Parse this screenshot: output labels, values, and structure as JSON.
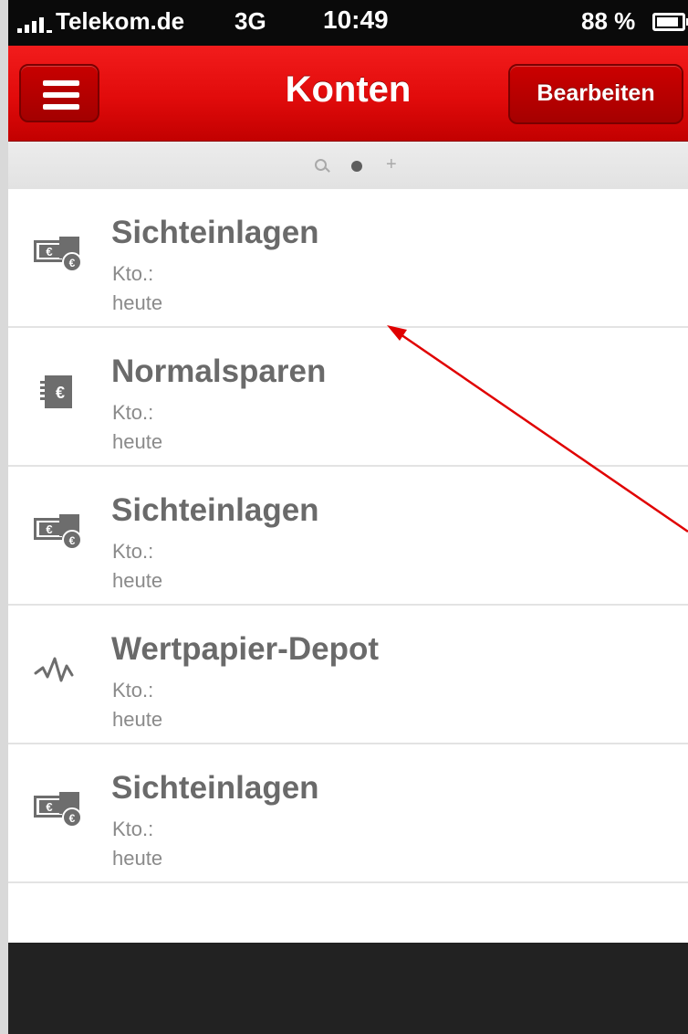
{
  "status_bar": {
    "carrier": "Telekom.de",
    "network": "3G",
    "time": "10:49",
    "battery_percent": "88 %",
    "battery_level": 0.88
  },
  "nav_bar": {
    "title": "Konten",
    "edit_label": "Bearbeiten",
    "accent_color": "#e10b0b"
  },
  "pager": {
    "pages": [
      "search",
      "accounts",
      "add"
    ],
    "active_page": "accounts"
  },
  "accounts": [
    {
      "name": "Sichteinlagen",
      "account_label": "Kto.:",
      "date": "heute",
      "icon": "cash-euro-icon"
    },
    {
      "name": "Normalsparen",
      "account_label": "Kto.:",
      "date": "heute",
      "icon": "savings-book-euro-icon"
    },
    {
      "name": "Sichteinlagen",
      "account_label": "Kto.:",
      "date": "heute",
      "icon": "cash-euro-icon"
    },
    {
      "name": "Wertpapier-Depot",
      "account_label": "Kto.:",
      "date": "heute",
      "icon": "stock-chart-icon"
    },
    {
      "name": "Sichteinlagen",
      "account_label": "Kto.:",
      "date": "heute",
      "icon": "cash-euro-icon"
    }
  ],
  "annotation": {
    "color": "#e00000"
  }
}
